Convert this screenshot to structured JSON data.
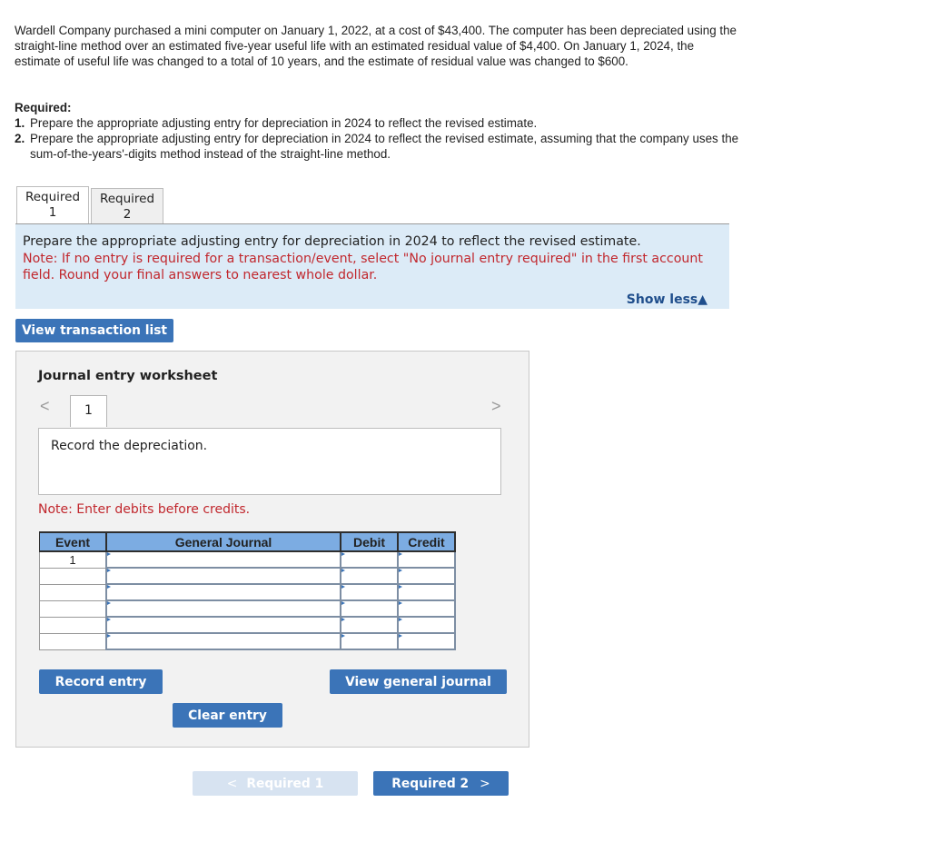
{
  "problem": {
    "text": "Wardell Company purchased a mini computer on January 1, 2022, at a cost of $43,400. The computer has been depreciated using the straight-line method over an estimated five-year useful life with an estimated residual value of $4,400. On January 1, 2024, the estimate of useful life was changed to a total of 10 years, and the estimate of residual value was changed to $600."
  },
  "required": {
    "title": "Required:",
    "items": [
      {
        "num": "1.",
        "text": "Prepare the appropriate adjusting entry for depreciation in 2024 to reflect the revised estimate."
      },
      {
        "num": "2.",
        "text": "Prepare the appropriate adjusting entry for depreciation in 2024 to reflect the revised estimate, assuming that the company uses the sum-of-the-years'-digits method instead of the straight-line method."
      }
    ]
  },
  "tabs": [
    {
      "line1": "Required",
      "line2": "1",
      "active": true
    },
    {
      "line1": "Required",
      "line2": "2",
      "active": false
    }
  ],
  "instruction": {
    "main": "Prepare the appropriate adjusting entry for depreciation in 2024 to reflect the revised estimate.",
    "note": "Note: If no entry is required for a transaction/event, select \"No journal entry required\" in the first account field. Round your final answers to nearest whole dollar.",
    "show_less": "Show less▲"
  },
  "view_transaction_list": "View transaction list",
  "worksheet": {
    "title": "Journal entry worksheet",
    "prev_icon": "<",
    "next_icon": ">",
    "page": "1",
    "description": "Record the depreciation.",
    "note": "Note: Enter debits before credits.",
    "columns": [
      "Event",
      "General Journal",
      "Debit",
      "Credit"
    ],
    "rows": [
      {
        "event": "1",
        "account": "",
        "debit": "",
        "credit": ""
      },
      {
        "event": "",
        "account": "",
        "debit": "",
        "credit": ""
      },
      {
        "event": "",
        "account": "",
        "debit": "",
        "credit": ""
      },
      {
        "event": "",
        "account": "",
        "debit": "",
        "credit": ""
      },
      {
        "event": "",
        "account": "",
        "debit": "",
        "credit": ""
      },
      {
        "event": "",
        "account": "",
        "debit": "",
        "credit": ""
      }
    ],
    "record_entry": "Record entry",
    "clear_entry": "Clear entry",
    "view_general_journal": "View general journal"
  },
  "nav": {
    "prev_label": "Required 1",
    "prev_icon": "<",
    "next_label": "Required 2",
    "next_icon": ">"
  }
}
